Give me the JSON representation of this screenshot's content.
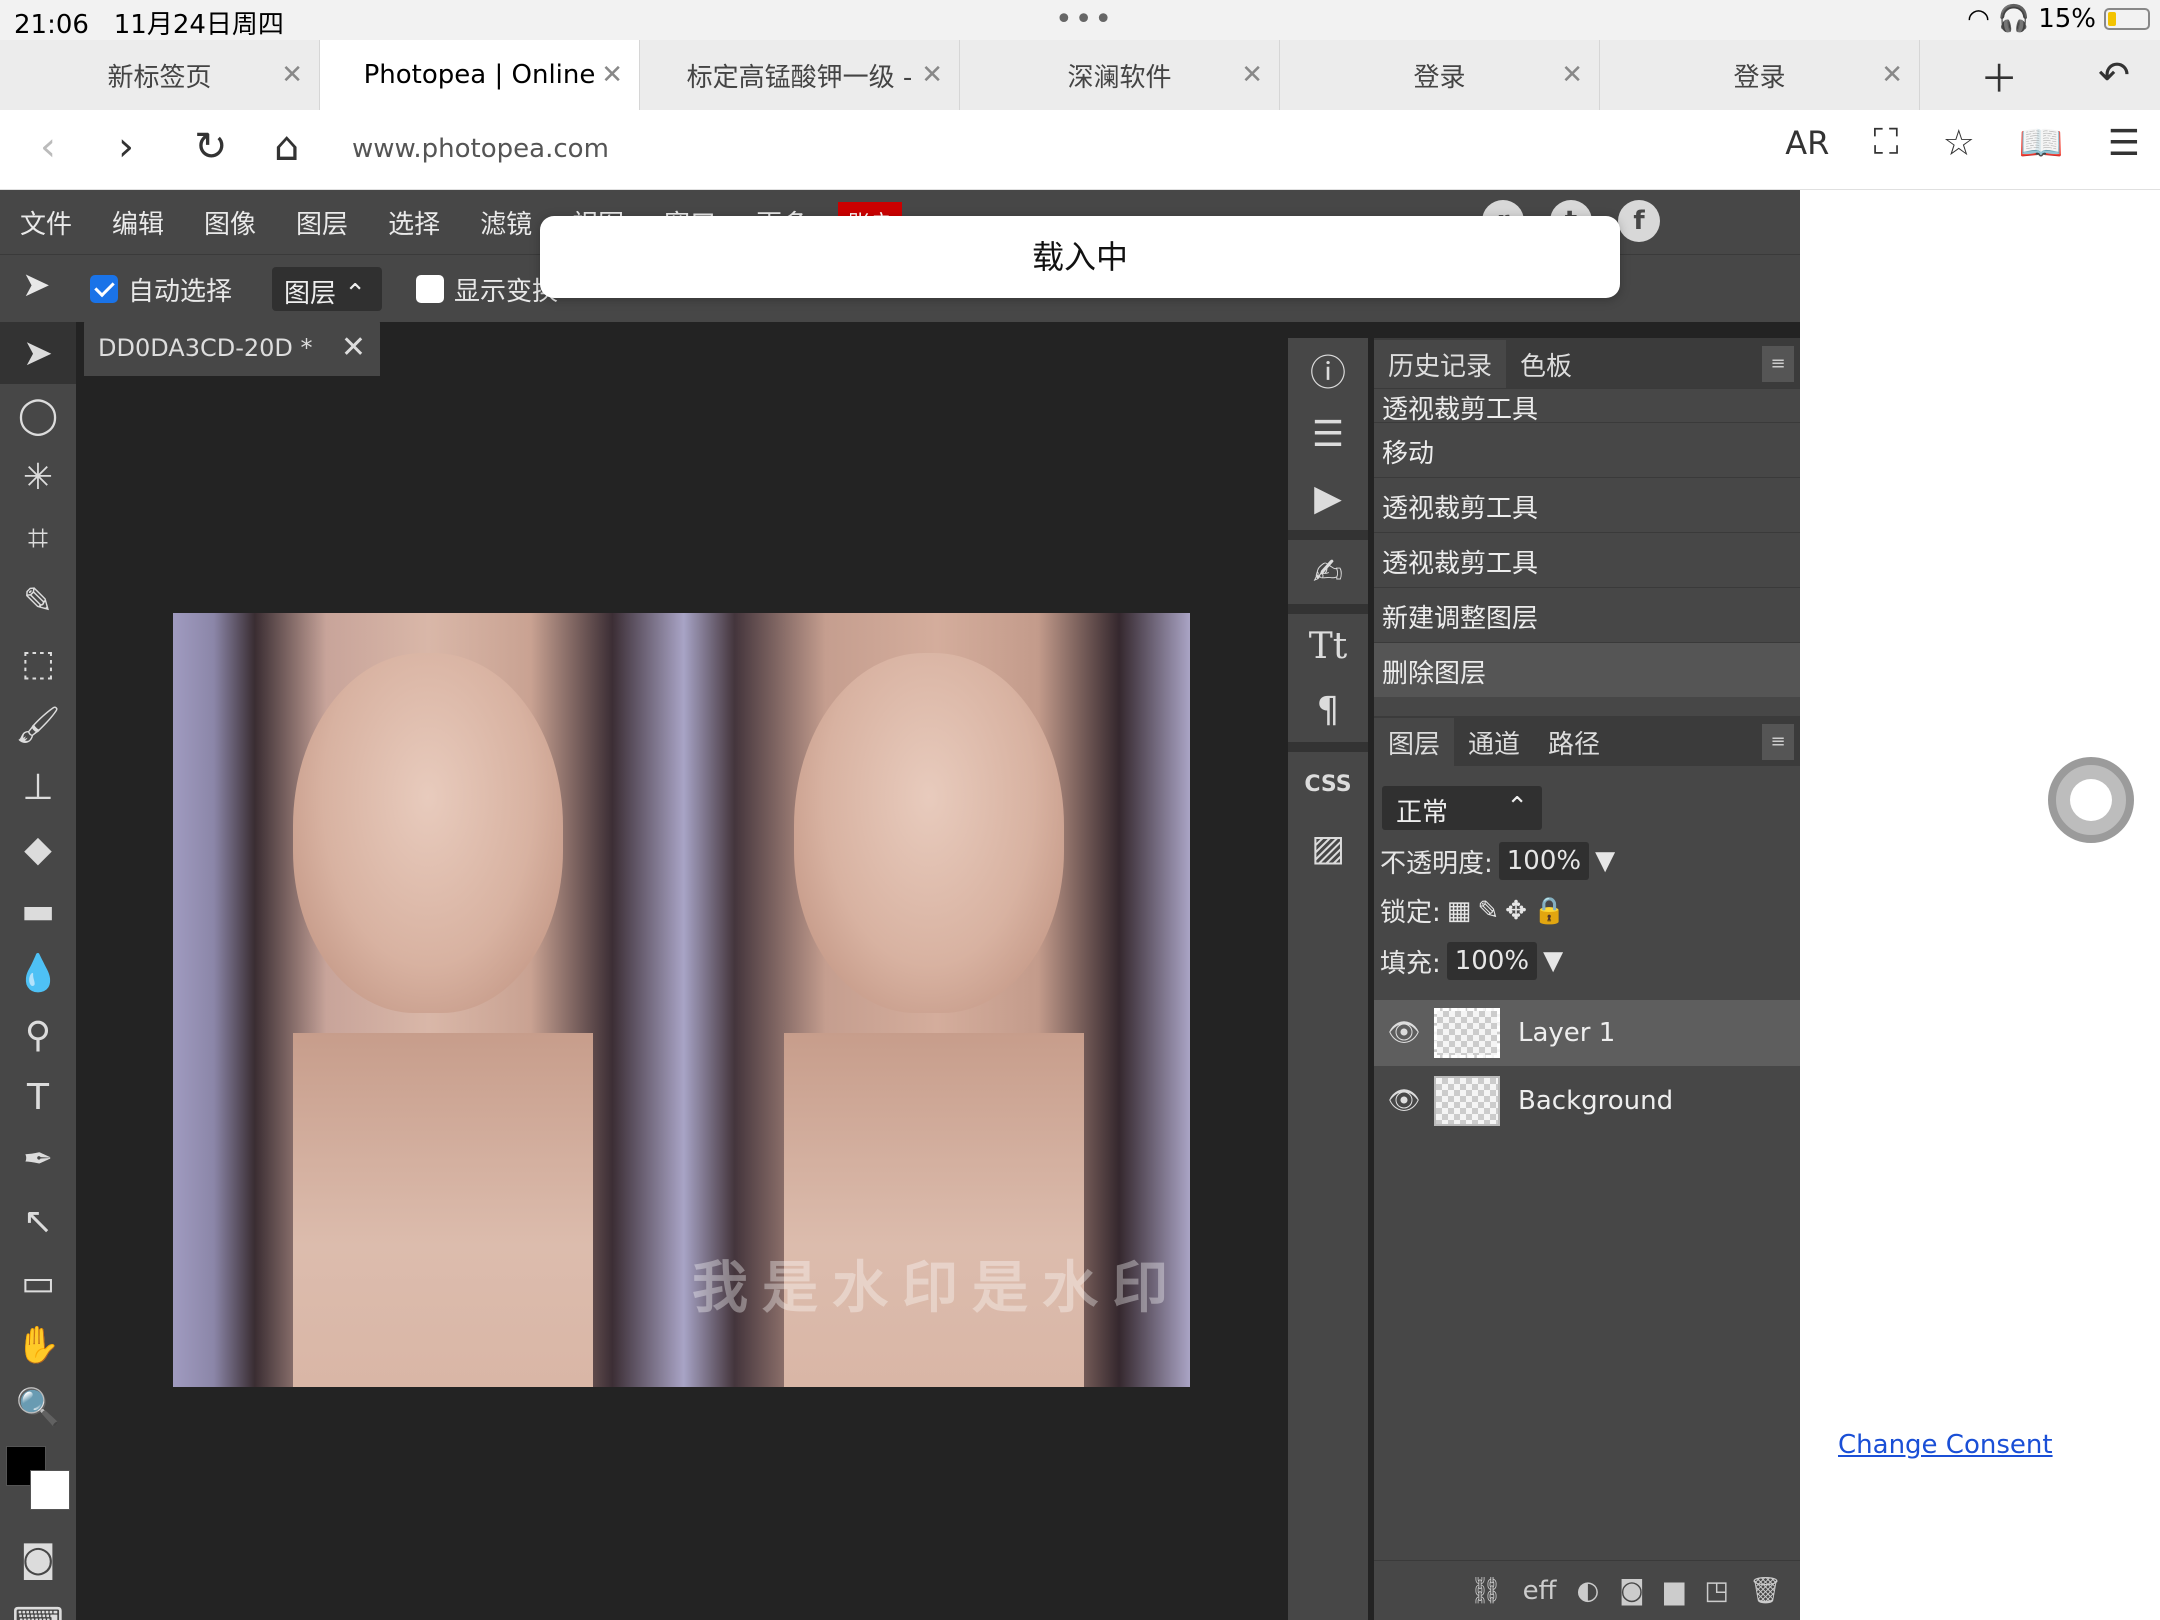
{
  "status": {
    "time": "21:06",
    "date": "11月24日周四",
    "battery": "15%"
  },
  "tabs": [
    {
      "label": "新标签页",
      "active": false
    },
    {
      "label": "Photopea | Online",
      "active": true
    },
    {
      "label": "标定高锰酸钾一级 -",
      "active": false
    },
    {
      "label": "深澜软件",
      "active": false
    },
    {
      "label": "登录",
      "active": false
    },
    {
      "label": "登录",
      "active": false
    }
  ],
  "address": {
    "url": "www.photopea.com",
    "ar_label": "AR"
  },
  "menu": [
    "文件",
    "编辑",
    "图像",
    "图层",
    "选择",
    "滤镜",
    "视图",
    "窗口",
    "更多"
  ],
  "menu_account": "账户",
  "options": {
    "auto_select": "自动选择",
    "layer_select": "图层",
    "show_transform": "显示变换"
  },
  "document": {
    "tab_title": "DD0DA3CD-20D *",
    "watermark": "我是水印是水印"
  },
  "loading": "载入中",
  "history": {
    "tabs": [
      "历史记录",
      "色板"
    ],
    "items": [
      "透视裁剪工具",
      "移动",
      "透视裁剪工具",
      "透视裁剪工具",
      "新建调整图层",
      "删除图层"
    ]
  },
  "layers": {
    "tabs": [
      "图层",
      "通道",
      "路径"
    ],
    "blend_mode": "正常",
    "opacity_label": "不透明度:",
    "opacity": "100%",
    "lock_label": "锁定:",
    "fill_label": "填充:",
    "fill": "100%",
    "items": [
      "Layer 1",
      "Background"
    ],
    "footer_fx": "eff"
  },
  "consent": "Change Consent",
  "icons": {
    "strip": [
      "info-icon",
      "adjust-icon",
      "play-icon",
      "brush-settings-icon",
      "character-icon",
      "paragraph-icon",
      "css-icon",
      "image-icon"
    ]
  }
}
